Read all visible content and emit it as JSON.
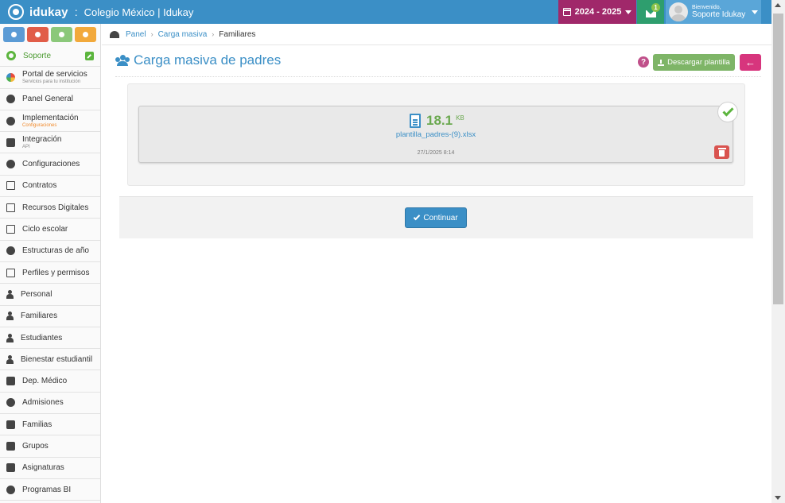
{
  "header": {
    "brand": "idukay",
    "separator": ":",
    "school": "Colegio México | Idukay",
    "school_year": "2024 - 2025",
    "messages_count": "1",
    "welcome": "Bienvenido,",
    "user_name": "Soporte Idukay"
  },
  "sidebar": {
    "support_label": "Soporte",
    "items": [
      {
        "label": "Portal de servicios",
        "sub": "Servicios para tu institución"
      },
      {
        "label": "Panel General"
      },
      {
        "label": "Implementación",
        "sub": "Configuraciones"
      },
      {
        "label": "Integración",
        "sub": "API"
      },
      {
        "label": "Configuraciones"
      },
      {
        "label": "Contratos"
      },
      {
        "label": "Recursos Digitales"
      },
      {
        "label": "Ciclo escolar"
      },
      {
        "label": "Estructuras de año"
      },
      {
        "label": "Perfiles y permisos"
      },
      {
        "label": "Personal"
      },
      {
        "label": "Familiares"
      },
      {
        "label": "Estudiantes"
      },
      {
        "label": "Bienestar estudiantil"
      },
      {
        "label": "Dep. Médico"
      },
      {
        "label": "Admisiones"
      },
      {
        "label": "Familias"
      },
      {
        "label": "Grupos"
      },
      {
        "label": "Asignaturas"
      },
      {
        "label": "Programas BI"
      }
    ]
  },
  "breadcrumb": {
    "items": [
      "Panel",
      "Carga masiva",
      "Familiares"
    ]
  },
  "page": {
    "title": "Carga masiva de padres",
    "help": "?",
    "download_label": "Descargar plantilla",
    "back_icon": "arrow-left-icon"
  },
  "upload": {
    "size_value": "18.1",
    "size_unit": "KB",
    "file_name": "plantilla_padres-(9).xlsx",
    "date": "27/1/2025 8:14"
  },
  "actions": {
    "continue_label": "Continuar"
  },
  "colors": {
    "topbar": "#3b8fc6",
    "year_box": "#a0286a",
    "mail_box": "#2e9e6e",
    "download": "#7eb567",
    "back": "#d7357d",
    "delete": "#d9534f",
    "success": "#5cb53e"
  }
}
